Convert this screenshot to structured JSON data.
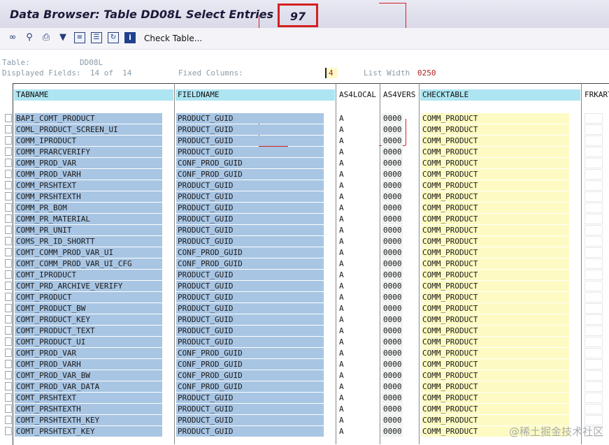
{
  "window": {
    "title": "Data Browser: Table DD08L Select Entries",
    "hit_count": "97"
  },
  "toolbar": {
    "icons": [
      "glasses-icon",
      "search-detail-icon",
      "print-icon",
      "filter-icon",
      "export-icon",
      "list-icon",
      "refresh-icon",
      "info-icon"
    ],
    "check_table_label": "Check Table..."
  },
  "info": {
    "table_label": "Table:",
    "table_value": "DD08L",
    "displayed_fields_text": "Displayed Fields:  14 of  14",
    "fixed_columns_label": "Fixed Columns:",
    "fixed_columns_value": "4",
    "list_width_label": "List Width",
    "list_width_value": "0250"
  },
  "columns": {
    "tabname": "TABNAME",
    "fieldname": "FIELDNAME",
    "as4local": "AS4LOCAL",
    "as4vers": "AS4VERS",
    "checktable": "CHECKTABLE",
    "frkart": "FRKART"
  },
  "rows": [
    {
      "tab": "BAPI_COMT_PRODUCT",
      "field": "PRODUCT_GUID",
      "local": "A",
      "vers": "0000",
      "check": "COMM_PRODUCT"
    },
    {
      "tab": "COML_PRODUCT_SCREEN_UI",
      "field": "PRODUCT_GUID",
      "local": "A",
      "vers": "0000",
      "check": "COMM_PRODUCT"
    },
    {
      "tab": "COMM_IPRODUCT",
      "field": "PRODUCT_GUID",
      "local": "A",
      "vers": "0000",
      "check": "COMM_PRODUCT"
    },
    {
      "tab": "COMM_PRARCVERIFY",
      "field": "PRODUCT_GUID",
      "local": "A",
      "vers": "0000",
      "check": "COMM_PRODUCT"
    },
    {
      "tab": "COMM_PROD_VAR",
      "field": "CONF_PROD_GUID",
      "local": "A",
      "vers": "0000",
      "check": "COMM_PRODUCT"
    },
    {
      "tab": "COMM_PROD_VARH",
      "field": "CONF_PROD_GUID",
      "local": "A",
      "vers": "0000",
      "check": "COMM_PRODUCT"
    },
    {
      "tab": "COMM_PRSHTEXT",
      "field": "PRODUCT_GUID",
      "local": "A",
      "vers": "0000",
      "check": "COMM_PRODUCT"
    },
    {
      "tab": "COMM_PRSHTEXTH",
      "field": "PRODUCT_GUID",
      "local": "A",
      "vers": "0000",
      "check": "COMM_PRODUCT"
    },
    {
      "tab": "COMM_PR_BOM",
      "field": "PRODUCT_GUID",
      "local": "A",
      "vers": "0000",
      "check": "COMM_PRODUCT"
    },
    {
      "tab": "COMM_PR_MATERIAL",
      "field": "PRODUCT_GUID",
      "local": "A",
      "vers": "0000",
      "check": "COMM_PRODUCT"
    },
    {
      "tab": "COMM_PR_UNIT",
      "field": "PRODUCT_GUID",
      "local": "A",
      "vers": "0000",
      "check": "COMM_PRODUCT"
    },
    {
      "tab": "COMS_PR_ID_SHORTT",
      "field": "PRODUCT_GUID",
      "local": "A",
      "vers": "0000",
      "check": "COMM_PRODUCT"
    },
    {
      "tab": "COMT_COMM_PROD_VAR_UI",
      "field": "CONF_PROD_GUID",
      "local": "A",
      "vers": "0000",
      "check": "COMM_PRODUCT"
    },
    {
      "tab": "COMT_COMM_PROD_VAR_UI_CFG",
      "field": "CONF_PROD_GUID",
      "local": "A",
      "vers": "0000",
      "check": "COMM_PRODUCT"
    },
    {
      "tab": "COMT_IPRODUCT",
      "field": "PRODUCT_GUID",
      "local": "A",
      "vers": "0000",
      "check": "COMM_PRODUCT"
    },
    {
      "tab": "COMT_PRD_ARCHIVE_VERIFY",
      "field": "PRODUCT_GUID",
      "local": "A",
      "vers": "0000",
      "check": "COMM_PRODUCT"
    },
    {
      "tab": "COMT_PRODUCT",
      "field": "PRODUCT_GUID",
      "local": "A",
      "vers": "0000",
      "check": "COMM_PRODUCT"
    },
    {
      "tab": "COMT_PRODUCT_BW",
      "field": "PRODUCT_GUID",
      "local": "A",
      "vers": "0000",
      "check": "COMM_PRODUCT"
    },
    {
      "tab": "COMT_PRODUCT_KEY",
      "field": "PRODUCT_GUID",
      "local": "A",
      "vers": "0000",
      "check": "COMM_PRODUCT"
    },
    {
      "tab": "COMT_PRODUCT_TEXT",
      "field": "PRODUCT_GUID",
      "local": "A",
      "vers": "0000",
      "check": "COMM_PRODUCT"
    },
    {
      "tab": "COMT_PRODUCT_UI",
      "field": "PRODUCT_GUID",
      "local": "A",
      "vers": "0000",
      "check": "COMM_PRODUCT"
    },
    {
      "tab": "COMT_PROD_VAR",
      "field": "CONF_PROD_GUID",
      "local": "A",
      "vers": "0000",
      "check": "COMM_PRODUCT"
    },
    {
      "tab": "COMT_PROD_VARH",
      "field": "CONF_PROD_GUID",
      "local": "A",
      "vers": "0000",
      "check": "COMM_PRODUCT"
    },
    {
      "tab": "COMT_PROD_VAR_BW",
      "field": "CONF_PROD_GUID",
      "local": "A",
      "vers": "0000",
      "check": "COMM_PRODUCT"
    },
    {
      "tab": "COMT_PROD_VAR_DATA",
      "field": "CONF_PROD_GUID",
      "local": "A",
      "vers": "0000",
      "check": "COMM_PRODUCT"
    },
    {
      "tab": "COMT_PRSHTEXT",
      "field": "PRODUCT_GUID",
      "local": "A",
      "vers": "0000",
      "check": "COMM_PRODUCT"
    },
    {
      "tab": "COMT_PRSHTEXTH",
      "field": "PRODUCT_GUID",
      "local": "A",
      "vers": "0000",
      "check": "COMM_PRODUCT"
    },
    {
      "tab": "COMT_PRSHTEXTH_KEY",
      "field": "PRODUCT_GUID",
      "local": "A",
      "vers": "0000",
      "check": "COMM_PRODUCT"
    },
    {
      "tab": "COMT_PRSHTEXT_KEY",
      "field": "PRODUCT_GUID",
      "local": "A",
      "vers": "0000",
      "check": "COMM_PRODUCT"
    }
  ],
  "watermark": "@稀土掘金技术社区",
  "colors": {
    "highlight_red": "#d42020",
    "header_cyan": "#aee5f2",
    "key_column_blue": "#a8c5e3",
    "checktable_yellow": "#fdfbc3"
  }
}
